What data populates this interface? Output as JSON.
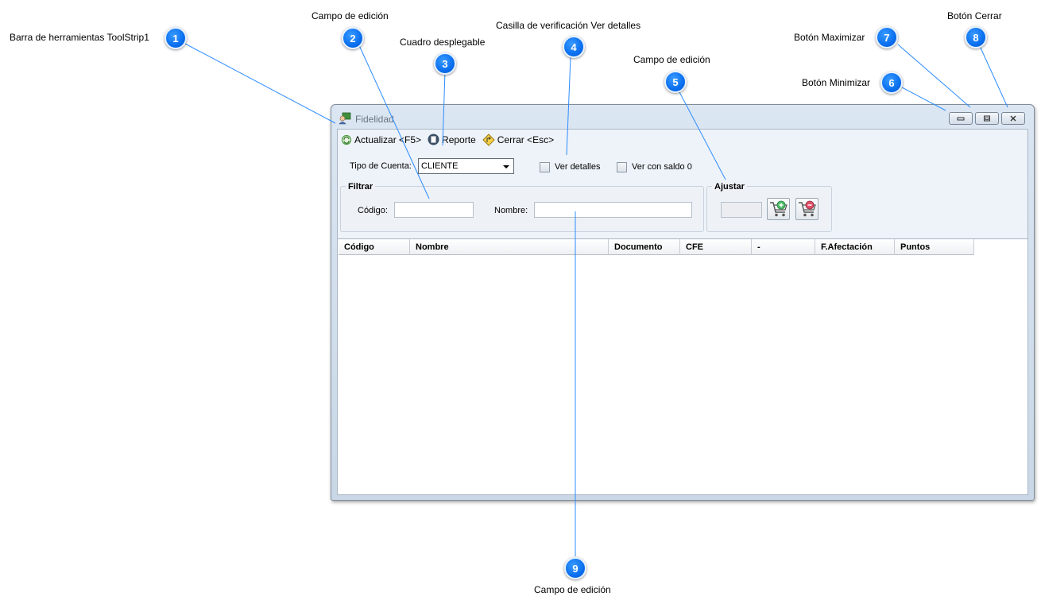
{
  "callouts": [
    {
      "n": "1",
      "label": "Barra de herramientas ToolStrip1"
    },
    {
      "n": "2",
      "label": "Campo de edición"
    },
    {
      "n": "3",
      "label": "Cuadro desplegable"
    },
    {
      "n": "4",
      "label": "Casilla de verificación Ver detalles"
    },
    {
      "n": "5",
      "label": "Campo de edición"
    },
    {
      "n": "6",
      "label": "Botón Minimizar"
    },
    {
      "n": "7",
      "label": "Botón Maximizar"
    },
    {
      "n": "8",
      "label": "Botón Cerrar"
    },
    {
      "n": "9",
      "label": "Campo de edición"
    }
  ],
  "window": {
    "title": "Fidelidad"
  },
  "toolbar": {
    "refresh_label": "Actualizar <F5>",
    "report_label": "Reporte",
    "close_label": "Cerrar <Esc>"
  },
  "filters": {
    "account_type_label": "Tipo de Cuenta:",
    "account_type_value": "CLIENTE",
    "details_label": "Ver detalles",
    "zero_balance_label": "Ver con saldo 0"
  },
  "filter_group": {
    "title": "Filtrar",
    "code_label": "Código:",
    "name_label": "Nombre:"
  },
  "adjust_group": {
    "title": "Ajustar"
  },
  "grid": {
    "columns": [
      "Código",
      "Nombre",
      "Documento",
      "CFE",
      "-",
      "F.Afectación",
      "Puntos"
    ]
  },
  "colors": {
    "badge": "#0a6ff0",
    "leader_line": "#2d8cff",
    "window_frame": "#c9d7e6"
  }
}
